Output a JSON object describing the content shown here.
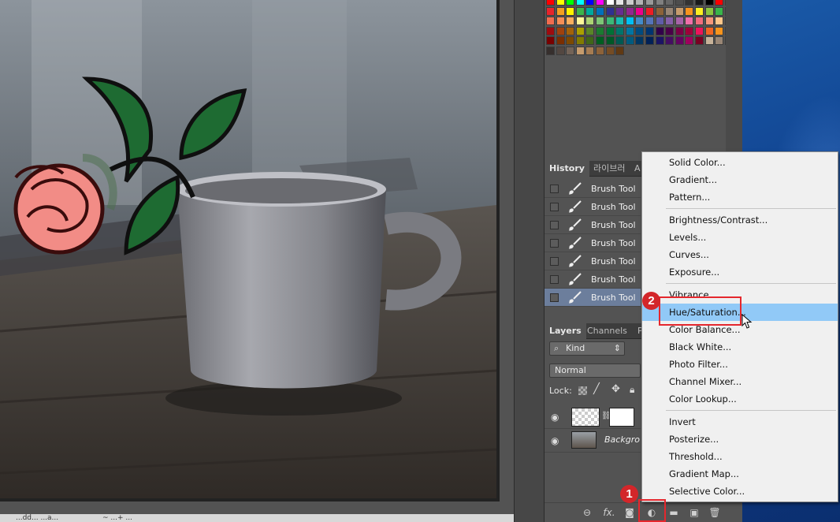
{
  "history": {
    "tabs": [
      "History",
      "라이브러",
      "A"
    ],
    "items": [
      "Brush Tool",
      "Brush Tool",
      "Brush Tool",
      "Brush Tool",
      "Brush Tool",
      "Brush Tool",
      "Brush Tool"
    ]
  },
  "layers": {
    "tabs": [
      "Layers",
      "Channels",
      "P"
    ],
    "kind": "Kind",
    "kind_arrows": "⇕",
    "blend_mode": "Normal",
    "lock_label": "Lock:",
    "items": [
      {
        "name": ""
      },
      {
        "name": "Backgro"
      }
    ]
  },
  "menu": {
    "items": [
      "Solid Color...",
      "Gradient...",
      "Pattern...",
      "Brightness/Contrast...",
      "Levels...",
      "Curves...",
      "Exposure...",
      "Vibrance...",
      "Hue/Saturation...",
      "Color Balance...",
      "Black  White...",
      "Photo Filter...",
      "Channel Mixer...",
      "Color Lookup...",
      "Invert",
      "Posterize...",
      "Threshold...",
      "Gradient Map...",
      "Selective Color..."
    ],
    "highlighted": "Hue/Saturation..."
  },
  "annotations": {
    "badge1": "1",
    "badge2": "2"
  },
  "status": {
    "left": "...dd... ...a...",
    "mid": "~ ...+ ..."
  },
  "icons": {
    "eye": "eye-icon",
    "brush": "brush-icon",
    "link": "link-icon",
    "fx": "fx-icon",
    "mask": "add-mask-icon",
    "adjustment": "adjustment-layer-icon",
    "folder": "folder-icon",
    "new_layer": "new-layer-icon",
    "trash": "trash-icon",
    "cursor": "mouse-cursor-icon"
  },
  "colors": {
    "menu_highlight": "#91c9f7",
    "annotation_red": "#d3262a",
    "history_selected": "#6c7e9c"
  }
}
